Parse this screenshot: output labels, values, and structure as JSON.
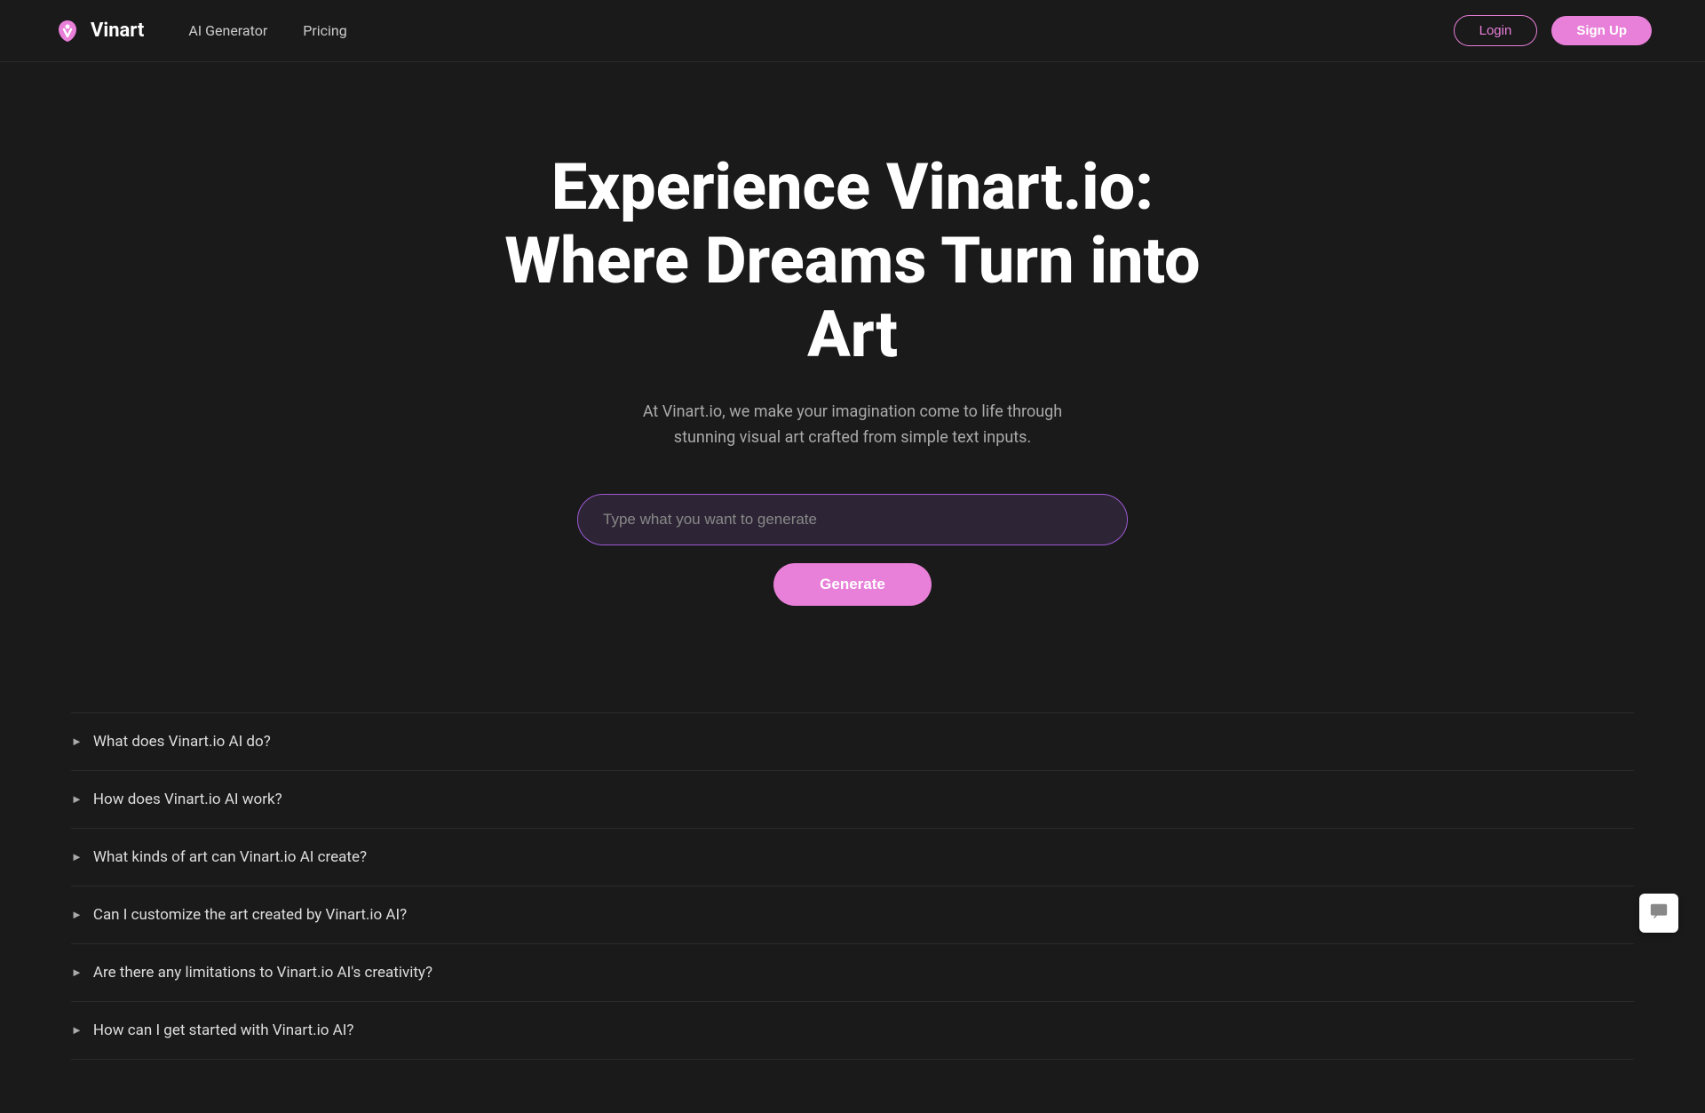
{
  "navbar": {
    "logo_text": "Vinart",
    "nav_links": [
      {
        "label": "AI Generator",
        "id": "ai-generator"
      },
      {
        "label": "Pricing",
        "id": "pricing"
      }
    ],
    "login_label": "Login",
    "signup_label": "Sign Up"
  },
  "hero": {
    "title": "Experience Vinart.io:\nWhere Dreams Turn into Art",
    "subtitle": "At Vinart.io, we make your imagination come to life through stunning visual art crafted from simple text inputs.",
    "input_placeholder": "Type what you want to generate",
    "generate_button_label": "Generate"
  },
  "faq": {
    "items": [
      {
        "question": "What does Vinart.io AI do?"
      },
      {
        "question": "How does Vinart.io AI work?"
      },
      {
        "question": "What kinds of art can Vinart.io AI create?"
      },
      {
        "question": "Can I customize the art created by Vinart.io AI?"
      },
      {
        "question": "Are there any limitations to Vinart.io AI's creativity?"
      },
      {
        "question": "How can I get started with Vinart.io AI?"
      }
    ]
  },
  "chat_widget": {
    "icon": "💬"
  }
}
